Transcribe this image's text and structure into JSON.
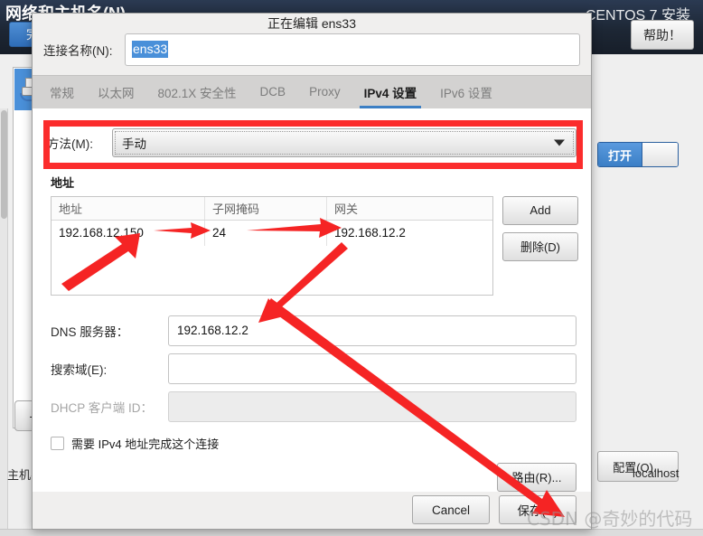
{
  "background": {
    "page_title": "网络和主机名(N)",
    "install_title": "CENTOS 7 安装",
    "done_label": "完成",
    "help_label": "帮助！",
    "toggle_on_label": "打开",
    "configure_label": "配置(O)...",
    "hostname_label": "主机名：",
    "hostname_value": "localhost",
    "minus_label": "-"
  },
  "dialog": {
    "title": "正在编辑 ens33",
    "connection_name_label": "连接名称(N):",
    "connection_name_value": "ens33",
    "tabs": [
      {
        "label": "常规",
        "active": false
      },
      {
        "label": "以太网",
        "active": false
      },
      {
        "label": "802.1X 安全性",
        "active": false
      },
      {
        "label": "DCB",
        "active": false
      },
      {
        "label": "Proxy",
        "active": false
      },
      {
        "label": "IPv4 设置",
        "active": true
      },
      {
        "label": "IPv6 设置",
        "active": false
      }
    ],
    "method": {
      "label": "方法(M):",
      "value": "手动"
    },
    "addresses": {
      "section_label": "地址",
      "columns": [
        "地址",
        "子网掩码",
        "网关"
      ],
      "rows": [
        [
          "192.168.12.150",
          "24",
          "192.168.12.2"
        ]
      ],
      "add_label": "Add",
      "delete_label": "删除(D)"
    },
    "dns": {
      "label": "DNS 服务器：",
      "value": "192.168.12.2"
    },
    "search_domain": {
      "label": "搜索域(E):",
      "value": ""
    },
    "dhcp_client_id": {
      "label": "DHCP 客户端 ID：",
      "value": ""
    },
    "require_ipv4": {
      "label": "需要 IPv4 地址完成这个连接",
      "checked": false
    },
    "routes_label": "路由(R)...",
    "cancel_label": "Cancel",
    "save_label": "保存(S)"
  },
  "annotations": {
    "highlight_color": "#fb2c2c",
    "watermark": "CSDN @奇妙的代码"
  }
}
